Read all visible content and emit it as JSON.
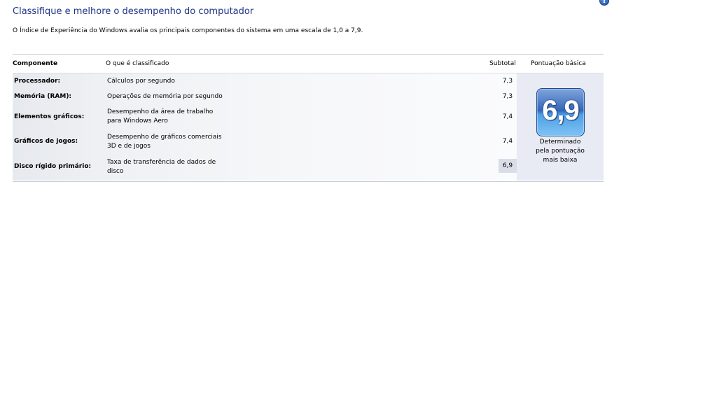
{
  "header": {
    "title": "Classifique e melhore o desempenho do computador",
    "subtitle": "O Índice de Experiência do Windows avalia os principais componentes do sistema em uma escala de 1,0 a 7,9.",
    "help_icon": "info-icon"
  },
  "table": {
    "columns": {
      "component": "Componente",
      "rated": "O que é classificado",
      "subtotal": "Subtotal",
      "base_score": "Pontuação básica"
    },
    "rows": [
      {
        "component": "Processador:",
        "rated_line1": "Cálculos por segundo",
        "rated_line2": "",
        "subtotal": "7,3"
      },
      {
        "component": "Memória (RAM):",
        "rated_line1": "Operações de memória por segundo",
        "rated_line2": "",
        "subtotal": "7,3"
      },
      {
        "component": "Elementos gráficos:",
        "rated_line1": "Desempenho da área de trabalho",
        "rated_line2": "para Windows Aero",
        "subtotal": "7,4"
      },
      {
        "component": "Gráficos de jogos:",
        "rated_line1": "Desempenho de gráficos comerciais",
        "rated_line2": "3D e de jogos",
        "subtotal": "7,4"
      },
      {
        "component": "Disco rígido primário:",
        "rated_line1": "Taxa de transferência de dados de",
        "rated_line2": "disco",
        "subtotal": "6,9"
      }
    ],
    "base_score": {
      "value": "6,9",
      "note_line1": "Determinado",
      "note_line2": "pela pontuação",
      "note_line3": "mais baixa"
    }
  },
  "colors": {
    "title": "#1e3287",
    "badge_top": "#2c5fb5",
    "badge_bottom": "#7dc3f3"
  }
}
